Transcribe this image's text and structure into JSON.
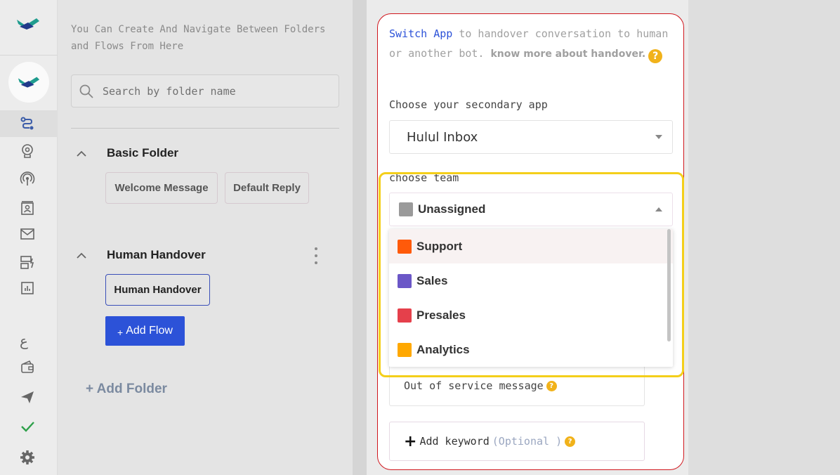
{
  "colors": {
    "accent": "#2c52d8",
    "highlight": "#f4cf1a",
    "card_border": "#d0161d",
    "help": "#f1b21a"
  },
  "rail": {
    "icons": [
      "logo-icon",
      "flows-icon",
      "brain-icon",
      "broadcast-icon",
      "contact-icon",
      "mail-icon",
      "forms-icon",
      "analytics-icon",
      "language-icon",
      "wallet-icon",
      "send-icon",
      "check-icon",
      "settings-icon"
    ],
    "language_glyph": "ع"
  },
  "panel": {
    "hint": "You Can Create And Navigate Between Folders and Flows From Here",
    "search_placeholder": "Search by folder name",
    "folders": [
      {
        "name": "Basic Folder",
        "flows": [
          "Welcome Message",
          "Default Reply"
        ]
      },
      {
        "name": "Human Handover",
        "flows": [
          "Human Handover"
        ]
      }
    ],
    "add_flow": "Add Flow",
    "add_flow_plus": "+",
    "add_folder": "+ Add Folder"
  },
  "config": {
    "intro_link": "Switch App",
    "intro_text": " to handover conversation to human or another bot. ",
    "intro_bold": "know more about handover.",
    "help_glyph": "?",
    "secondary_app_label": "Choose your secondary app",
    "secondary_app_value": "Hulul Inbox",
    "team_label": "choose team",
    "team_selected": {
      "label": "Unassigned",
      "color": "#9a9a9a"
    },
    "team_options": [
      {
        "label": "Support",
        "color": "#ff5a0a"
      },
      {
        "label": "Sales",
        "color": "#6b57c7"
      },
      {
        "label": "Presales",
        "color": "#e5404b"
      },
      {
        "label": "Analytics",
        "color": "#ffa800"
      }
    ],
    "out_of_service": "Out of service message",
    "add_keyword_plus": "+",
    "add_keyword": "Add keyword",
    "add_keyword_optional": "(Optional )"
  }
}
